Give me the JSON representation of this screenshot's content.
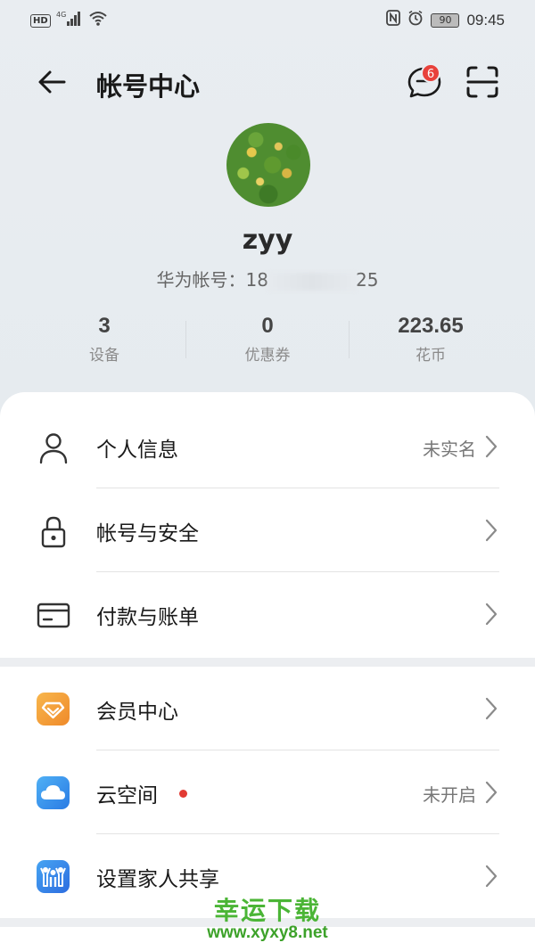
{
  "status_bar": {
    "hd": "HD",
    "network": "4G",
    "battery": "90",
    "time": "09:45"
  },
  "header": {
    "title": "帐号中心",
    "message_badge": "6"
  },
  "profile": {
    "username": "zyy",
    "account_label": "华为帐号：",
    "account_prefix": "18",
    "account_suffix": "25"
  },
  "stats": [
    {
      "value": "3",
      "label": "设备"
    },
    {
      "value": "0",
      "label": "优惠券"
    },
    {
      "value": "223.65",
      "label": "花币"
    }
  ],
  "menu_group1": [
    {
      "label": "个人信息",
      "value": "未实名",
      "icon": "person-icon"
    },
    {
      "label": "帐号与安全",
      "value": "",
      "icon": "lock-icon"
    },
    {
      "label": "付款与账单",
      "value": "",
      "icon": "card-icon"
    }
  ],
  "menu_group2": [
    {
      "label": "会员中心",
      "value": "",
      "icon": "vip-diamond-icon"
    },
    {
      "label": "云空间",
      "value": "未开启",
      "icon": "cloud-icon"
    },
    {
      "label": "设置家人共享",
      "value": "",
      "icon": "family-icon"
    }
  ],
  "watermark": {
    "title": "幸运下载",
    "url": "www.xyxy8.net"
  },
  "colors": {
    "badge_red": "#e8413b",
    "watermark_green": "#4bb536"
  }
}
